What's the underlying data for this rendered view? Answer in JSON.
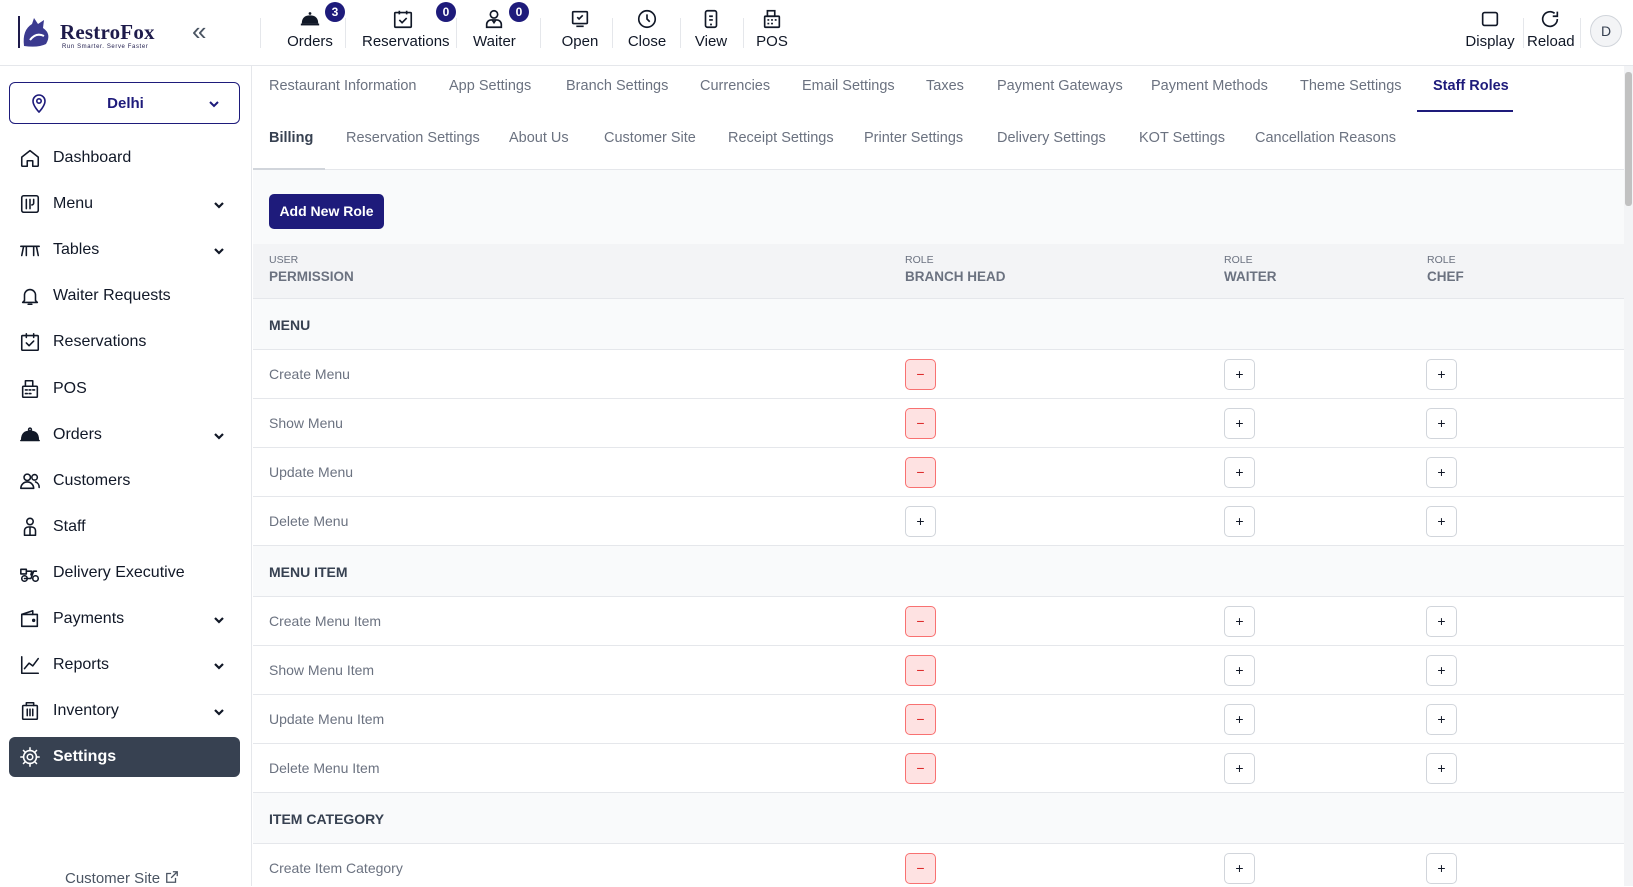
{
  "brand": {
    "name": "RestroFox",
    "tagline": "Run Smarter. Serve Faster"
  },
  "topbar": {
    "orders": {
      "label": "Orders",
      "badge": "3"
    },
    "reservations": {
      "label": "Reservations",
      "badge": "0"
    },
    "waiter": {
      "label": "Waiter",
      "badge": "0"
    },
    "open": "Open",
    "close": "Close",
    "view": "View",
    "pos": "POS",
    "display": "Display",
    "reload": "Reload",
    "avatar": "D"
  },
  "sidebar": {
    "location": "Delhi",
    "items": [
      {
        "label": "Dashboard",
        "icon": "home-icon",
        "dropdown": false
      },
      {
        "label": "Menu",
        "icon": "menu-book-icon",
        "dropdown": true
      },
      {
        "label": "Tables",
        "icon": "table-icon",
        "dropdown": true
      },
      {
        "label": "Waiter Requests",
        "icon": "bell-icon",
        "dropdown": false
      },
      {
        "label": "Reservations",
        "icon": "calendar-check-icon",
        "dropdown": false
      },
      {
        "label": "POS",
        "icon": "pos-icon",
        "dropdown": false
      },
      {
        "label": "Orders",
        "icon": "cloche-icon",
        "dropdown": true
      },
      {
        "label": "Customers",
        "icon": "users-icon",
        "dropdown": false
      },
      {
        "label": "Staff",
        "icon": "staff-icon",
        "dropdown": false
      },
      {
        "label": "Delivery Executive",
        "icon": "scooter-icon",
        "dropdown": false
      },
      {
        "label": "Payments",
        "icon": "wallet-icon",
        "dropdown": true
      },
      {
        "label": "Reports",
        "icon": "chart-icon",
        "dropdown": true
      },
      {
        "label": "Inventory",
        "icon": "box-icon",
        "dropdown": true
      },
      {
        "label": "Settings",
        "icon": "gear-icon",
        "dropdown": false,
        "active": true
      }
    ],
    "customer_site": "Customer Site"
  },
  "tabs_row1": [
    "Restaurant Information",
    "App Settings",
    "Branch Settings",
    "Currencies",
    "Email Settings",
    "Taxes",
    "Payment Gateways",
    "Payment Methods",
    "Theme Settings",
    "Staff Roles"
  ],
  "tabs_row2": [
    "Billing",
    "Reservation Settings",
    "About Us",
    "Customer Site",
    "Receipt Settings",
    "Printer Settings",
    "Delivery Settings",
    "KOT Settings",
    "Cancellation Reasons"
  ],
  "active_tab": "Staff Roles",
  "add_role_label": "Add New Role",
  "table": {
    "header": {
      "user_small": "USER",
      "user_label": "PERMISSION",
      "roles": [
        {
          "small": "ROLE",
          "label": "BRANCH HEAD"
        },
        {
          "small": "ROLE",
          "label": "WAITER"
        },
        {
          "small": "ROLE",
          "label": "CHEF"
        }
      ]
    },
    "groups": [
      {
        "title": "MENU",
        "rows": [
          {
            "label": "Create Menu",
            "perms": [
              "minus",
              "plus",
              "plus"
            ]
          },
          {
            "label": "Show Menu",
            "perms": [
              "minus",
              "plus",
              "plus"
            ]
          },
          {
            "label": "Update Menu",
            "perms": [
              "minus",
              "plus",
              "plus"
            ]
          },
          {
            "label": "Delete Menu",
            "perms": [
              "plus",
              "plus",
              "plus"
            ]
          }
        ]
      },
      {
        "title": "MENU ITEM",
        "rows": [
          {
            "label": "Create Menu Item",
            "perms": [
              "minus",
              "plus",
              "plus"
            ]
          },
          {
            "label": "Show Menu Item",
            "perms": [
              "minus",
              "plus",
              "plus"
            ]
          },
          {
            "label": "Update Menu Item",
            "perms": [
              "minus",
              "plus",
              "plus"
            ]
          },
          {
            "label": "Delete Menu Item",
            "perms": [
              "minus",
              "plus",
              "plus"
            ]
          }
        ]
      },
      {
        "title": "ITEM CATEGORY",
        "rows": [
          {
            "label": "Create Item Category",
            "perms": [
              "minus",
              "plus",
              "plus"
            ]
          }
        ]
      }
    ]
  },
  "symbols": {
    "plus": "+",
    "minus": "−"
  },
  "colors": {
    "primary": "#1e1b7b",
    "active_nav": "#374151",
    "minus_bg": "#fee2e2",
    "minus_border": "#f87171"
  }
}
